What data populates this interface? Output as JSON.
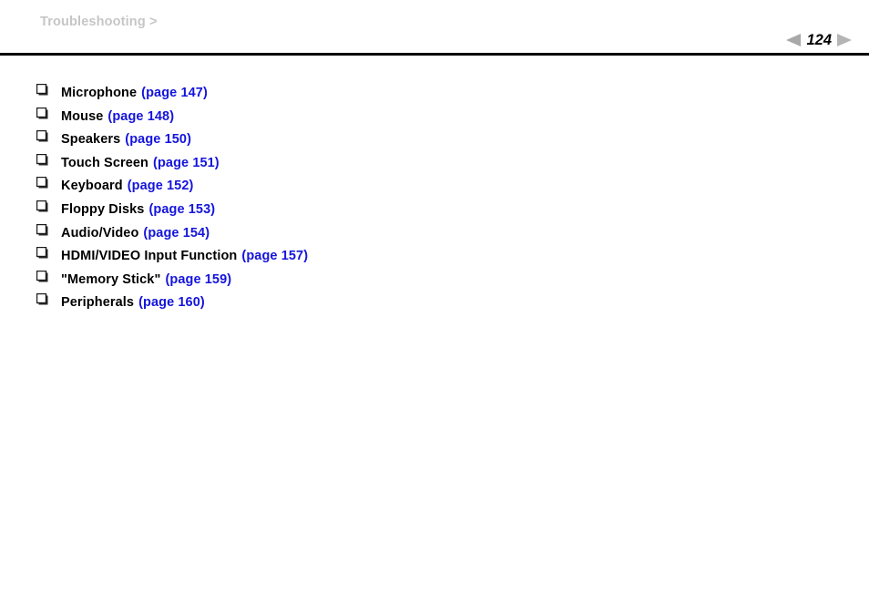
{
  "header": {
    "breadcrumb": "Troubleshooting >",
    "pager": {
      "prev_icon": "triangle-left-icon",
      "page_number": "124",
      "next_icon": "triangle-right-icon"
    }
  },
  "colors": {
    "link_blue": "#1414dc",
    "breadcrumb_gray": "#c6c6c6",
    "rule_black": "#000000",
    "arrow_gray": "#a8a8a8"
  },
  "list": {
    "bullet_icon": "shadowed-square-bullet-icon",
    "items": [
      {
        "label": "Microphone",
        "page_ref": "(page 147)"
      },
      {
        "label": "Mouse",
        "page_ref": "(page 148)"
      },
      {
        "label": "Speakers",
        "page_ref": "(page 150)"
      },
      {
        "label": "Touch Screen",
        "page_ref": "(page 151)"
      },
      {
        "label": "Keyboard",
        "page_ref": "(page 152)"
      },
      {
        "label": "Floppy Disks",
        "page_ref": "(page 153)"
      },
      {
        "label": "Audio/Video",
        "page_ref": "(page 154)"
      },
      {
        "label": "HDMI/VIDEO Input Function",
        "page_ref": "(page 157)"
      },
      {
        "label": "\"Memory Stick\"",
        "page_ref": "(page 159)"
      },
      {
        "label": "Peripherals",
        "page_ref": "(page 160)"
      }
    ]
  }
}
